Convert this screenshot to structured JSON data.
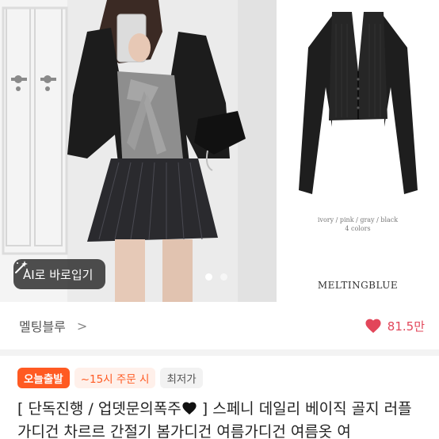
{
  "gallery": {
    "ai_button_label": "AI로 바로입기",
    "pagination": {
      "total": 2,
      "active": 0
    },
    "colors_caption": "ivory / pink / gray / black",
    "colors_count": "4 colors",
    "brand_mark": "MELTINGBLUE"
  },
  "store": {
    "name": "멜팅블루",
    "chevron": ">",
    "likes": "81.5만"
  },
  "badges": {
    "today": "오늘출발",
    "cutoff": "~15시 주문 시",
    "lowest": "최저가"
  },
  "product": {
    "title_part1": "[ 단독진행 / 업뎃문의폭주",
    "title_part2": " ] 스페니 데일리 베이직 골지 러플 가디건 차르르 간절기 봄가디건 여름가디건 여름옷 여"
  },
  "colors": {
    "accent": "#ff5a22",
    "like_heart": "#e2465a"
  }
}
